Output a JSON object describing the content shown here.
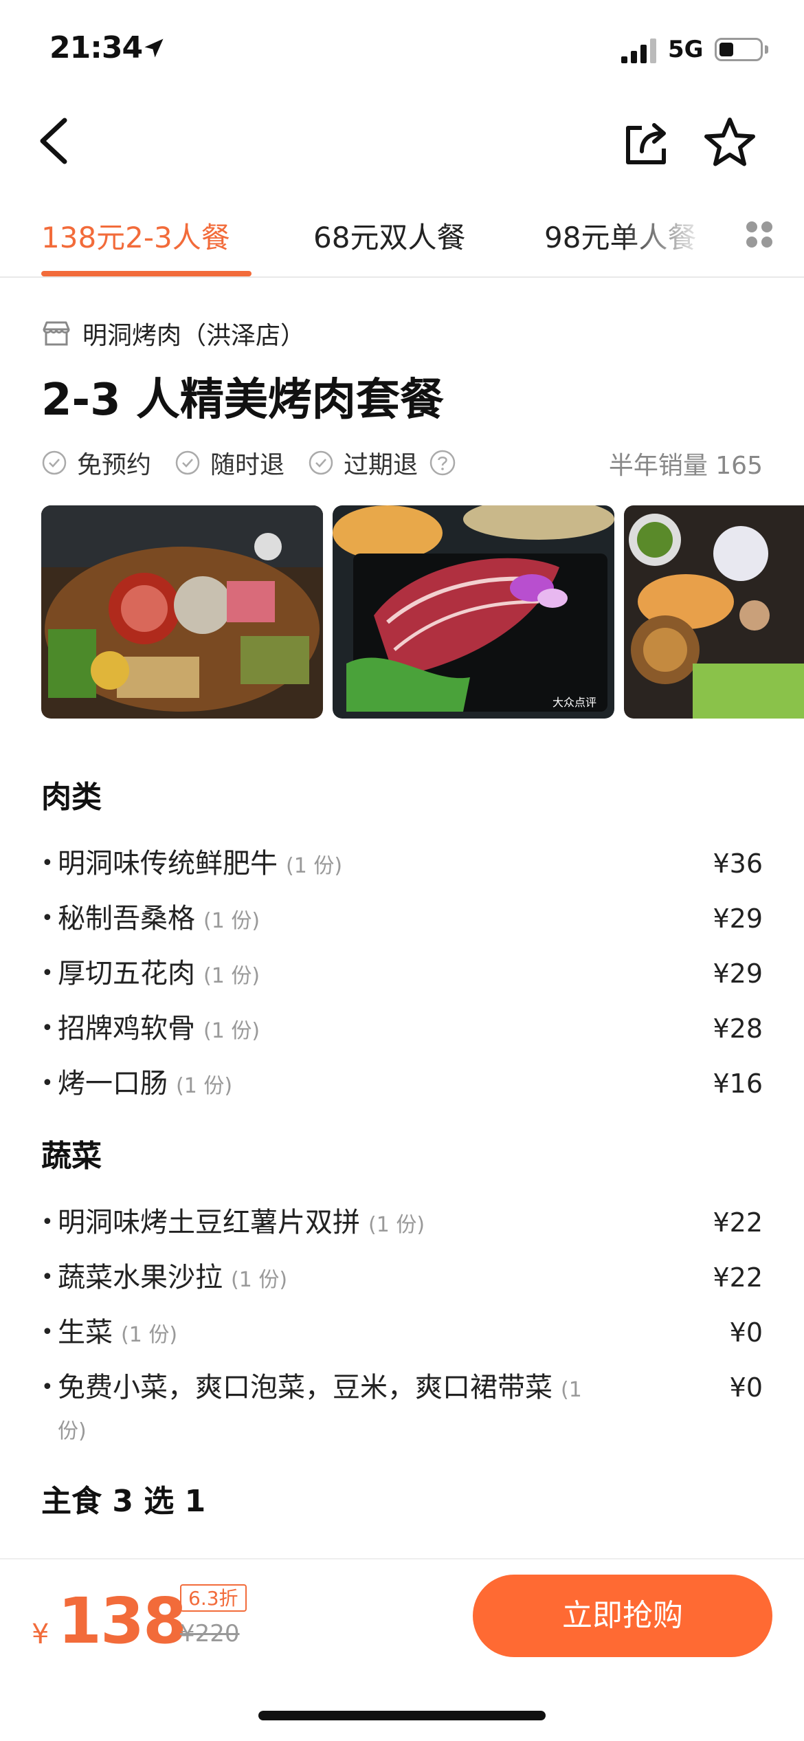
{
  "status_bar": {
    "time": "21:34",
    "network": "5G",
    "battery_level": 0.35
  },
  "nav": {
    "back_icon": "chevron-left-icon",
    "share_icon": "share-icon",
    "favorite_icon": "star-icon"
  },
  "tabs": [
    {
      "label": "138元2-3人餐",
      "active": true
    },
    {
      "label": "68元双人餐",
      "active": false
    },
    {
      "label": "98元单人餐",
      "active": false
    }
  ],
  "shop": {
    "name": "明洞烤肉（洪泽店）"
  },
  "deal": {
    "title": "2-3 人精美烤肉套餐",
    "tags": [
      "免预约",
      "随时退",
      "过期退"
    ],
    "sales": "半年销量 165"
  },
  "gallery": {
    "watermark": "大众点评"
  },
  "menu": [
    {
      "title": "肉类",
      "items": [
        {
          "name": "明洞味传统鲜肥牛",
          "qty": "(1 份)",
          "price": "¥36"
        },
        {
          "name": "秘制吾桑格",
          "qty": "(1 份)",
          "price": "¥29"
        },
        {
          "name": "厚切五花肉",
          "qty": "(1 份)",
          "price": "¥29"
        },
        {
          "name": "招牌鸡软骨",
          "qty": "(1 份)",
          "price": "¥28"
        },
        {
          "name": "烤一口肠",
          "qty": "(1 份)",
          "price": "¥16"
        }
      ]
    },
    {
      "title": "蔬菜",
      "items": [
        {
          "name": "明洞味烤土豆红薯片双拼",
          "qty": "(1 份)",
          "price": "¥22"
        },
        {
          "name": "蔬菜水果沙拉",
          "qty": "(1 份)",
          "price": "¥22"
        },
        {
          "name": "生菜",
          "qty": "(1 份)",
          "price": "¥0"
        },
        {
          "name": "免费小菜，爽口泡菜，豆米，爽口裙带菜",
          "qty": "(1 份)",
          "price": "¥0"
        }
      ]
    },
    {
      "title": "主食 3 选 1",
      "items": []
    }
  ],
  "bottom": {
    "currency": "¥",
    "price": "138",
    "discount": "6.3折",
    "original_price": "¥220",
    "buy_label": "立即抢购"
  },
  "colors": {
    "accent": "#f26b3a",
    "button": "#ff6a33"
  }
}
